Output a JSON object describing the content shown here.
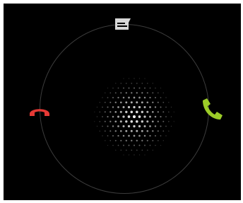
{
  "lockscreen": {
    "ring_color": "#3c3c3c",
    "targets": [
      {
        "icon": "message-icon",
        "color": "#d8d8d8"
      },
      {
        "icon": "decline-call-icon",
        "color": "#e53935"
      },
      {
        "icon": "answer-call-icon",
        "color": "#9ccc28"
      }
    ],
    "handle": {
      "icon": "dot-grid-handle-icon",
      "color": "#ffffff"
    }
  }
}
